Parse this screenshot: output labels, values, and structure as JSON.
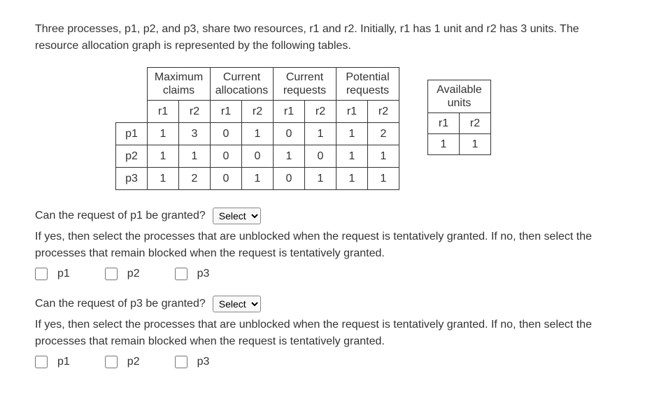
{
  "intro": "Three processes, p1, p2, and p3, share two resources, r1 and r2. Initially, r1 has 1 unit and r2 has 3 units. The resource allocation graph is represented by the following tables.",
  "main_table": {
    "group_headers": [
      "Maximum claims",
      "Current allocations",
      "Current requests",
      "Potential requests"
    ],
    "sub_headers": [
      "r1",
      "r2",
      "r1",
      "r2",
      "r1",
      "r2",
      "r1",
      "r2"
    ],
    "rows": [
      {
        "label": "p1",
        "cells": [
          "1",
          "3",
          "0",
          "1",
          "0",
          "1",
          "1",
          "2"
        ]
      },
      {
        "label": "p2",
        "cells": [
          "1",
          "1",
          "0",
          "0",
          "1",
          "0",
          "1",
          "1"
        ]
      },
      {
        "label": "p3",
        "cells": [
          "1",
          "2",
          "0",
          "1",
          "0",
          "1",
          "1",
          "1"
        ]
      }
    ]
  },
  "avail_table": {
    "header": "Available units",
    "sub_headers": [
      "r1",
      "r2"
    ],
    "values": [
      "1",
      "1"
    ]
  },
  "q1": {
    "question": "Can the request of p1 be granted?",
    "select_placeholder": "Select",
    "followup": "If yes, then select the processes that are unblocked when the request is tentatively granted. If no, then select the processes that remain blocked when the request is tentatively granted.",
    "checkboxes": [
      "p1",
      "p2",
      "p3"
    ]
  },
  "q2": {
    "question": "Can the request of p3 be granted?",
    "select_placeholder": "Select",
    "followup": "If yes, then select the processes that are unblocked when the request is tentatively granted. If no, then select the processes that remain blocked when the request is tentatively granted.",
    "checkboxes": [
      "p1",
      "p2",
      "p3"
    ]
  }
}
